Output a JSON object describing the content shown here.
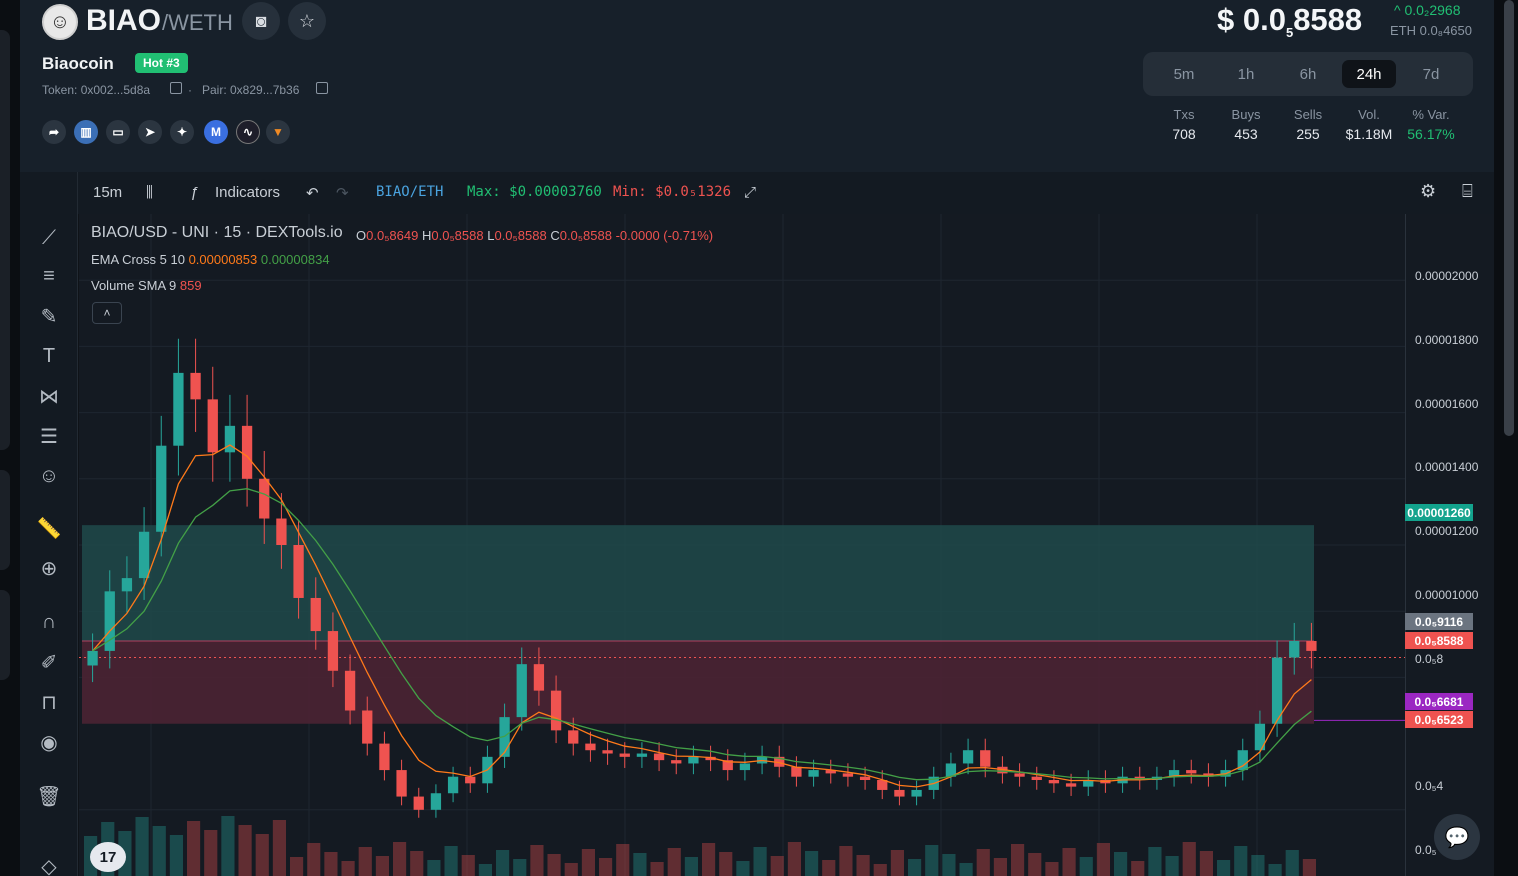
{
  "token": {
    "symbol": "BIAO",
    "quote": "/WETH",
    "name": "Biaocoin",
    "badge": "Hot #3",
    "token_addr": "Token: 0x002...5d8a",
    "pair_addr": "Pair: 0x829...7b36",
    "sep": "·"
  },
  "price": {
    "main_prefix": "$ 0.0",
    "main_sub": "5",
    "main_suffix": "8588",
    "change": "^ 0.0₂2968",
    "eth": "ETH 0.0₈4650"
  },
  "timeframes": [
    {
      "label": "5m",
      "active": false
    },
    {
      "label": "1h",
      "active": false
    },
    {
      "label": "6h",
      "active": false
    },
    {
      "label": "24h",
      "active": true
    },
    {
      "label": "7d",
      "active": false
    }
  ],
  "stats": [
    {
      "label": "Txs",
      "value": "708"
    },
    {
      "label": "Buys",
      "value": "453"
    },
    {
      "label": "Sells",
      "value": "255"
    },
    {
      "label": "Vol.",
      "value": "$1.18M"
    },
    {
      "label": "% Var.",
      "value": "56.17%"
    }
  ],
  "toolbar": {
    "interval": "15m",
    "indicators": "Indicators",
    "pair": "BIAO/ETH",
    "max": "Max: $0.00003760",
    "min": "Min: $0.0₅1326"
  },
  "chart_legend": {
    "series": "BIAO/USD - UNI · 15 · DEXTools.io",
    "o_label": "O",
    "o": "0.0₅8649",
    "h_label": "H",
    "h": "0.0₅8588",
    "l_label": "L",
    "l": "0.0₅8588",
    "c_label": "C",
    "c": "0.0₅8588",
    "change": "-0.0000 (-0.71%)",
    "ema_label": "EMA Cross 5 10",
    "ema_a": "0.00000853",
    "ema_b": "0.00000834",
    "vol_label": "Volume SMA 9",
    "vol_val": "859"
  },
  "colors": {
    "up": "#26a69a",
    "down": "#ef5350",
    "green_zone": "#1f4a4a",
    "red_zone": "#4a2333",
    "accent_green": "#21bf73"
  },
  "chart_data": {
    "type": "line",
    "description_series": "BIAO/USD 15m candles",
    "y_ticks": [
      "0.00002000",
      "0.00001800",
      "0.00001600",
      "0.00001400",
      "0.00001200",
      "0.00001000",
      "0.0₅8",
      "0.0₅4",
      "0.0₅"
    ],
    "badges": [
      {
        "label": "0.00001260",
        "color": "#13a38d"
      },
      {
        "label": "0.0₅9116",
        "color": "#6b7480"
      },
      {
        "label": "0.0₅8588",
        "color": "#ef5350"
      },
      {
        "label": "0.0₅6681",
        "color": "#9b27c2"
      },
      {
        "label": "0.0₅6523",
        "color": "#ef5350"
      }
    ],
    "close": [
      8.8e-06,
      1.06e-05,
      1.1e-05,
      1.24e-05,
      1.5e-05,
      1.72e-05,
      1.64e-05,
      1.48e-05,
      1.56e-05,
      1.4e-05,
      1.28e-05,
      1.2e-05,
      1.04e-05,
      9.4e-06,
      8.2e-06,
      7e-06,
      6e-06,
      5.2e-06,
      4.4e-06,
      4e-06,
      4.5e-06,
      5e-06,
      4.8e-06,
      5.6e-06,
      6.8e-06,
      8.4e-06,
      7.6e-06,
      6.4e-06,
      6e-06,
      5.8e-06,
      5.7e-06,
      5.6e-06,
      5.7e-06,
      5.5e-06,
      5.4e-06,
      5.6e-06,
      5.5e-06,
      5.2e-06,
      5.4e-06,
      5.6e-06,
      5.3e-06,
      5e-06,
      5.2e-06,
      5.1e-06,
      5e-06,
      4.9e-06,
      4.6e-06,
      4.4e-06,
      4.6e-06,
      5e-06,
      5.4e-06,
      5.8e-06,
      5.3e-06,
      5.1e-06,
      5e-06,
      4.9e-06,
      4.8e-06,
      4.7e-06,
      4.9e-06,
      4.8e-06,
      5e-06,
      4.9e-06,
      5e-06,
      5.2e-06,
      5.1e-06,
      5e-06,
      5.2e-06,
      5.8e-06,
      6.6e-06,
      8.6e-06,
      9.1e-06,
      8.8e-06
    ]
  }
}
